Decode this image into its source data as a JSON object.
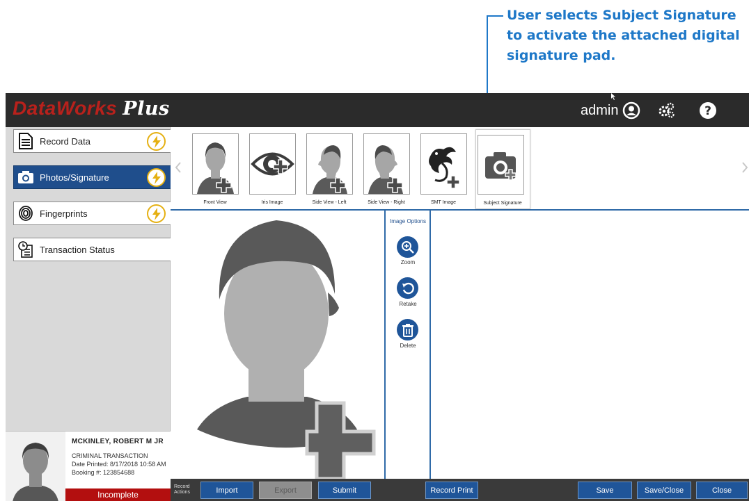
{
  "callout": {
    "text": "User selects Subject Signature to activate the attached digital signature pad."
  },
  "app": {
    "logo_main": "DataWorks",
    "logo_plus": "Plus",
    "user": "admin"
  },
  "nav": {
    "items": [
      {
        "label": "Record Data",
        "icon": "document-icon"
      },
      {
        "label": "Photos/Signature",
        "icon": "camera-icon"
      },
      {
        "label": "Fingerprints",
        "icon": "fingerprint-icon"
      },
      {
        "label": "Transaction Status",
        "icon": "clock-list-icon"
      }
    ]
  },
  "record": {
    "name": "MCKINLEY,  ROBERT  M  JR",
    "type": "CRIMINAL TRANSACTION",
    "date_printed": "Date Printed: 8/17/2018 10:58 AM",
    "booking": "Booking #: 123854688",
    "status": "Incomplete"
  },
  "images": {
    "thumbs": [
      {
        "label": "Front View",
        "icon": "front-face-icon"
      },
      {
        "label": "Iris Image",
        "icon": "eye-icon"
      },
      {
        "label": "Side View - Left",
        "icon": "profile-left-icon"
      },
      {
        "label": "Side View - Right",
        "icon": "profile-right-icon"
      },
      {
        "label": "SMT Image",
        "icon": "dragon-icon"
      },
      {
        "label": "Subject Signature",
        "icon": "camera-icon"
      }
    ]
  },
  "options": {
    "title": "Image Options",
    "zoom": "Zoom",
    "retake": "Retake",
    "delete": "Delete"
  },
  "toolbar": {
    "record_label_1": "Record",
    "record_label_2": "Actions",
    "import": "Import",
    "export": "Export",
    "submit": "Submit",
    "record_print": "Record Print",
    "save": "Save",
    "save_close": "Save/Close",
    "close": "Close"
  },
  "colors": {
    "accent": "#1f5599",
    "brand_red": "#b8211c",
    "status_red": "#b30f0f",
    "bolt_yellow": "#e5b012",
    "callout_blue": "#1e78c8"
  }
}
